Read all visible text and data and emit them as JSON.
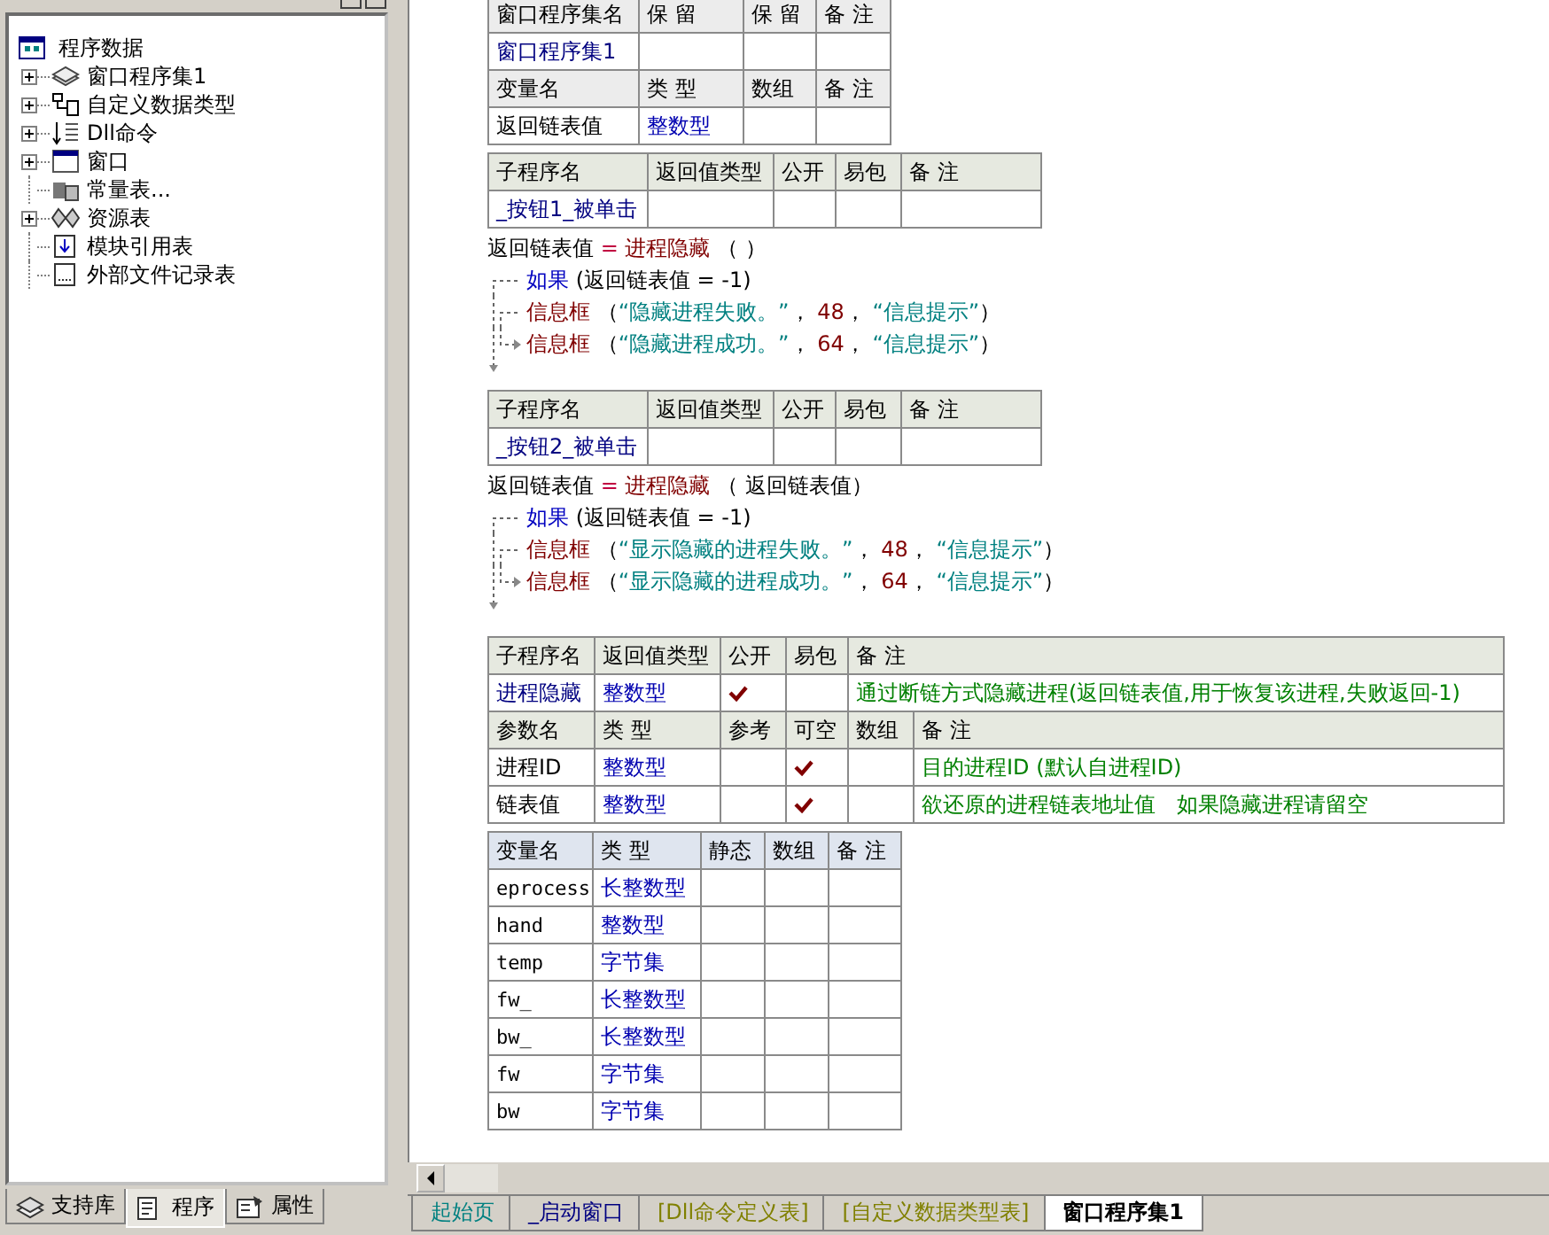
{
  "tree": {
    "label": "程序数据",
    "children": [
      {
        "label": "窗口程序集1",
        "kind": "branch"
      },
      {
        "label": "自定义数据类型",
        "kind": "branch"
      },
      {
        "label": "Dll命令",
        "kind": "branch"
      },
      {
        "label": "窗口",
        "kind": "branch"
      },
      {
        "label": "常量表...",
        "kind": "leaf"
      },
      {
        "label": "资源表",
        "kind": "branch"
      },
      {
        "label": "模块引用表",
        "kind": "leaf"
      },
      {
        "label": "外部文件记录表",
        "kind": "leaf"
      }
    ]
  },
  "panel_tabs": [
    {
      "label": "支持库",
      "selected": false
    },
    {
      "label": "程序",
      "selected": true
    },
    {
      "label": "属性",
      "selected": false
    }
  ],
  "editor": {
    "blocks": [
      {
        "kind": "assembly",
        "rows": [
          [
            {
              "kind": "head",
              "text": "窗口程序集名"
            },
            {
              "kind": "head",
              "text": "保 留"
            },
            {
              "kind": "head",
              "text": "保 留"
            },
            {
              "kind": "head",
              "text": "备 注"
            }
          ],
          [
            {
              "kind": "name",
              "text": "窗口程序集1"
            },
            {
              "kind": "empty"
            },
            {
              "kind": "empty"
            },
            {
              "kind": "empty"
            }
          ],
          [
            {
              "kind": "head",
              "text": "变量名"
            },
            {
              "kind": "head",
              "text": "类 型"
            },
            {
              "kind": "head",
              "text": "数组"
            },
            {
              "kind": "head",
              "text": "备 注"
            }
          ],
          [
            {
              "kind": "plain",
              "text": "返回链表值"
            },
            {
              "kind": "type",
              "text": "整数型"
            },
            {
              "kind": "empty"
            },
            {
              "kind": "empty"
            }
          ]
        ]
      },
      {
        "kind": "handler",
        "rows": [
          [
            {
              "kind": "head",
              "text": "子程序名"
            },
            {
              "kind": "head",
              "text": "返回值类型"
            },
            {
              "kind": "head",
              "text": "公开"
            },
            {
              "kind": "head",
              "text": "易包"
            },
            {
              "kind": "head",
              "text": "备 注"
            }
          ],
          [
            {
              "kind": "name",
              "text": "_按钮1_被单击"
            },
            {
              "kind": "empty"
            },
            {
              "kind": "check",
              "checked": false
            },
            {
              "kind": "check",
              "checked": false
            },
            {
              "kind": "empty"
            }
          ]
        ]
      },
      {
        "kind": "code",
        "lines": [
          {
            "kind": "stmt",
            "tokens": [
              {
                "kind": "plain",
                "text": "返回链表值"
              },
              {
                "kind": "op",
                "text": " = "
              },
              {
                "kind": "cmd",
                "text": "进程隐藏"
              },
              {
                "kind": "plain",
                "text": " （ ）"
              }
            ]
          },
          {
            "kind": "if",
            "tokens": [
              {
                "kind": "flow",
                "text": "如果"
              },
              {
                "kind": "plain",
                "text": " (返回链表值 = -1)"
              }
            ]
          },
          {
            "kind": "then",
            "tokens": [
              {
                "kind": "cmd",
                "text": "信息框"
              },
              {
                "kind": "plain",
                "text": " （"
              },
              {
                "kind": "str",
                "text": "“隐藏进程失败。”"
              },
              {
                "kind": "plain",
                "text": "， "
              },
              {
                "kind": "num",
                "text": "48"
              },
              {
                "kind": "plain",
                "text": "， "
              },
              {
                "kind": "str",
                "text": "“信息提示”"
              },
              {
                "kind": "plain",
                "text": "）"
              }
            ]
          },
          {
            "kind": "else",
            "tokens": [
              {
                "kind": "cmd",
                "text": "信息框"
              },
              {
                "kind": "plain",
                "text": " （"
              },
              {
                "kind": "str",
                "text": "“隐藏进程成功。”"
              },
              {
                "kind": "plain",
                "text": "， "
              },
              {
                "kind": "num",
                "text": "64"
              },
              {
                "kind": "plain",
                "text": "， "
              },
              {
                "kind": "str",
                "text": "“信息提示”"
              },
              {
                "kind": "plain",
                "text": "）"
              }
            ]
          }
        ]
      },
      {
        "kind": "handler",
        "rows": [
          [
            {
              "kind": "head",
              "text": "子程序名"
            },
            {
              "kind": "head",
              "text": "返回值类型"
            },
            {
              "kind": "head",
              "text": "公开"
            },
            {
              "kind": "head",
              "text": "易包"
            },
            {
              "kind": "head",
              "text": "备 注"
            }
          ],
          [
            {
              "kind": "name",
              "text": "_按钮2_被单击"
            },
            {
              "kind": "empty"
            },
            {
              "kind": "check",
              "checked": false
            },
            {
              "kind": "check",
              "checked": false
            },
            {
              "kind": "empty"
            }
          ]
        ]
      },
      {
        "kind": "code",
        "lines": [
          {
            "kind": "stmt",
            "tokens": [
              {
                "kind": "plain",
                "text": "返回链表值"
              },
              {
                "kind": "op",
                "text": " = "
              },
              {
                "kind": "cmd",
                "text": "进程隐藏"
              },
              {
                "kind": "plain",
                "text": " （ 返回链表值）"
              }
            ]
          },
          {
            "kind": "if",
            "tokens": [
              {
                "kind": "flow",
                "text": "如果"
              },
              {
                "kind": "plain",
                "text": " (返回链表值 = -1)"
              }
            ]
          },
          {
            "kind": "then",
            "tokens": [
              {
                "kind": "cmd",
                "text": "信息框"
              },
              {
                "kind": "plain",
                "text": " （"
              },
              {
                "kind": "str",
                "text": "“显示隐藏的进程失败。”"
              },
              {
                "kind": "plain",
                "text": "， "
              },
              {
                "kind": "num",
                "text": "48"
              },
              {
                "kind": "plain",
                "text": "， "
              },
              {
                "kind": "str",
                "text": "“信息提示”"
              },
              {
                "kind": "plain",
                "text": "）"
              }
            ]
          },
          {
            "kind": "else",
            "tokens": [
              {
                "kind": "cmd",
                "text": "信息框"
              },
              {
                "kind": "plain",
                "text": " （"
              },
              {
                "kind": "str",
                "text": "“显示隐藏的进程成功。”"
              },
              {
                "kind": "plain",
                "text": "， "
              },
              {
                "kind": "num",
                "text": "64"
              },
              {
                "kind": "plain",
                "text": "， "
              },
              {
                "kind": "str",
                "text": "“信息提示”"
              },
              {
                "kind": "plain",
                "text": "）"
              }
            ]
          }
        ]
      },
      {
        "kind": "procedure",
        "rows": [
          [
            {
              "kind": "head",
              "text": "子程序名"
            },
            {
              "kind": "head",
              "text": "返回值类型"
            },
            {
              "kind": "head",
              "text": "公开"
            },
            {
              "kind": "head",
              "text": "易包"
            },
            {
              "kind": "head",
              "text": "备 注"
            }
          ],
          [
            {
              "kind": "name",
              "text": "进程隐藏"
            },
            {
              "kind": "type",
              "text": "整数型"
            },
            {
              "kind": "check",
              "checked": true
            },
            {
              "kind": "check",
              "checked": false
            },
            {
              "kind": "note",
              "text": "通过断链方式隐藏进程(返回链表值,用于恢复该进程,失败返回-1)"
            }
          ],
          [
            {
              "kind": "head",
              "text": "参数名"
            },
            {
              "kind": "head",
              "text": "类 型"
            },
            {
              "kind": "head",
              "text": "参考"
            },
            {
              "kind": "head",
              "text": "可空"
            },
            {
              "kind": "head",
              "text": "数组"
            },
            {
              "kind": "head",
              "text": "备 注"
            }
          ],
          [
            {
              "kind": "plain",
              "text": "进程ID"
            },
            {
              "kind": "type",
              "text": "整数型"
            },
            {
              "kind": "check",
              "checked": false
            },
            {
              "kind": "check",
              "checked": true
            },
            {
              "kind": "check",
              "checked": false
            },
            {
              "kind": "note",
              "text": "目的进程ID (默认自进程ID)"
            }
          ],
          [
            {
              "kind": "plain",
              "text": "链表值"
            },
            {
              "kind": "type",
              "text": "整数型"
            },
            {
              "kind": "check",
              "checked": false
            },
            {
              "kind": "check",
              "checked": true
            },
            {
              "kind": "check",
              "checked": false
            },
            {
              "kind": "note",
              "text": "欲还原的进程链表地址值　如果隐藏进程请留空"
            }
          ]
        ]
      },
      {
        "kind": "locals",
        "rows": [
          [
            {
              "kind": "head",
              "text": "变量名"
            },
            {
              "kind": "head",
              "text": "类 型"
            },
            {
              "kind": "head",
              "text": "静态"
            },
            {
              "kind": "head",
              "text": "数组"
            },
            {
              "kind": "head",
              "text": "备 注"
            }
          ],
          [
            {
              "kind": "var",
              "text": "eprocess"
            },
            {
              "kind": "type",
              "text": "长整数型"
            },
            {
              "kind": "check",
              "checked": false
            },
            {
              "kind": "empty"
            },
            {
              "kind": "empty"
            }
          ],
          [
            {
              "kind": "var",
              "text": "hand"
            },
            {
              "kind": "type",
              "text": "整数型"
            },
            {
              "kind": "check",
              "checked": false
            },
            {
              "kind": "empty"
            },
            {
              "kind": "empty"
            }
          ],
          [
            {
              "kind": "var",
              "text": "temp"
            },
            {
              "kind": "type",
              "text": "字节集"
            },
            {
              "kind": "check",
              "checked": false
            },
            {
              "kind": "empty"
            },
            {
              "kind": "empty"
            }
          ],
          [
            {
              "kind": "var",
              "text": "fw_"
            },
            {
              "kind": "type",
              "text": "长整数型"
            },
            {
              "kind": "check",
              "checked": false
            },
            {
              "kind": "empty"
            },
            {
              "kind": "empty"
            }
          ],
          [
            {
              "kind": "var",
              "text": "bw_"
            },
            {
              "kind": "type",
              "text": "长整数型"
            },
            {
              "kind": "check",
              "checked": false
            },
            {
              "kind": "empty"
            },
            {
              "kind": "empty"
            }
          ],
          [
            {
              "kind": "var",
              "text": "fw"
            },
            {
              "kind": "type",
              "text": "字节集"
            },
            {
              "kind": "check",
              "checked": false
            },
            {
              "kind": "empty"
            },
            {
              "kind": "empty"
            }
          ],
          [
            {
              "kind": "var",
              "text": "bw"
            },
            {
              "kind": "type",
              "text": "字节集"
            },
            {
              "kind": "check",
              "checked": false
            },
            {
              "kind": "empty"
            },
            {
              "kind": "empty"
            }
          ]
        ]
      }
    ]
  },
  "doc_tabs": [
    {
      "label": "起始页",
      "selected": false,
      "color": "#008080"
    },
    {
      "label": "_启动窗口",
      "selected": false,
      "color": "#000080"
    },
    {
      "label": "[Dll命令定义表]",
      "selected": false,
      "color": "#808000"
    },
    {
      "label": "[自定义数据类型表]",
      "selected": false,
      "color": "#808000"
    },
    {
      "label": "窗口程序集1",
      "selected": true,
      "color": "#000000"
    }
  ]
}
